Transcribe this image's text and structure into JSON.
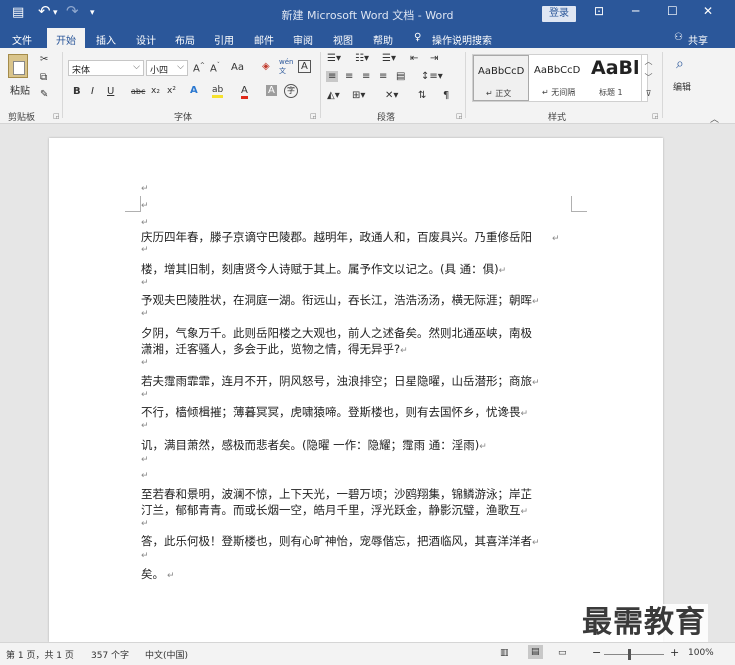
{
  "titlebar": {
    "title": "新建 Microsoft Word 文档 - Word",
    "login": "登录",
    "save_icon": "▤",
    "undo_icon": "↶",
    "redo_icon": "↷",
    "more_icon": "▾",
    "layout_icon": "⊡",
    "min_icon": "─",
    "max_icon": "☐",
    "close_icon": "✕"
  },
  "menu": {
    "tabs": [
      "文件",
      "开始",
      "插入",
      "设计",
      "布局",
      "引用",
      "邮件",
      "审阅",
      "视图",
      "帮助"
    ],
    "tell_me": "操作说明搜索",
    "share": "共享",
    "lightbulb_icon": "♀",
    "person_icon": "⚇"
  },
  "ribbon": {
    "clipboard": {
      "paste": "粘贴",
      "label": "剪贴板"
    },
    "font": {
      "name": "宋体",
      "size": "小四",
      "grow": "A",
      "shrink": "A",
      "case": "Aa",
      "clear": "◈",
      "phonetic": "wén",
      "phonetic2": "文",
      "border_char": "A",
      "bold": "B",
      "italic": "I",
      "underline": "U",
      "strike": "abc",
      "sub": "x₂",
      "sup": "x²",
      "effects": "A",
      "highlight": "ab",
      "color": "A",
      "shade": "A",
      "enclose": "字",
      "label": "字体"
    },
    "paragraph": {
      "label": "段落"
    },
    "styles": {
      "items": [
        {
          "preview": "AaBbCcD",
          "name": "↵ 正文"
        },
        {
          "preview": "AaBbCcD",
          "name": "↵ 无间隔"
        },
        {
          "preview": "AaBl",
          "name": "标题 1"
        }
      ],
      "label": "样式"
    },
    "editing": {
      "label": "编辑",
      "find_icon": "⌕"
    }
  },
  "document": {
    "paragraphs": [
      "庆历四年春，滕子京谪守巴陵郡。越明年，政通人和，百废具兴。乃重修岳阳",
      "楼，增其旧制，刻唐贤今人诗赋于其上。属予作文以记之。(具 通：俱)",
      "予观夫巴陵胜状，在洞庭一湖。衔远山，吞长江，浩浩汤汤，横无际涯；朝晖",
      "夕阴，气象万千。此则岳阳楼之大观也，前人之述备矣。然则北通巫峡，南极",
      "潇湘，迁客骚人，多会于此，览物之情，得无异乎?",
      "若夫霪雨霏霏，连月不开，阴风怒号，浊浪排空；日星隐曜，山岳潜形；商旅",
      "不行，樯倾楫摧；薄暮冥冥，虎啸猿啼。登斯楼也，则有去国怀乡，忧谗畏",
      "讥，满目萧然，感极而悲者矣。(隐曜 一作：隐耀；霪雨 通：淫雨)",
      "至若春和景明，波澜不惊，上下天光，一碧万顷；沙鸥翔集，锦鳞游泳；岸芷",
      "汀兰，郁郁青青。而或长烟一空，皓月千里，浮光跃金，静影沉璧，渔歌互",
      "答，此乐何极！登斯楼也，则有心旷神怡，宠辱偕忘，把酒临风，其喜洋洋者",
      "矣。"
    ],
    "paragraph_mark": "↵"
  },
  "status": {
    "page": "第 1 页，共 1 页",
    "words": "357 个字",
    "language": "中文(中国)",
    "zoom": "100%",
    "zoom_minus": "−",
    "zoom_plus": "+"
  },
  "watermark": "最需教育"
}
